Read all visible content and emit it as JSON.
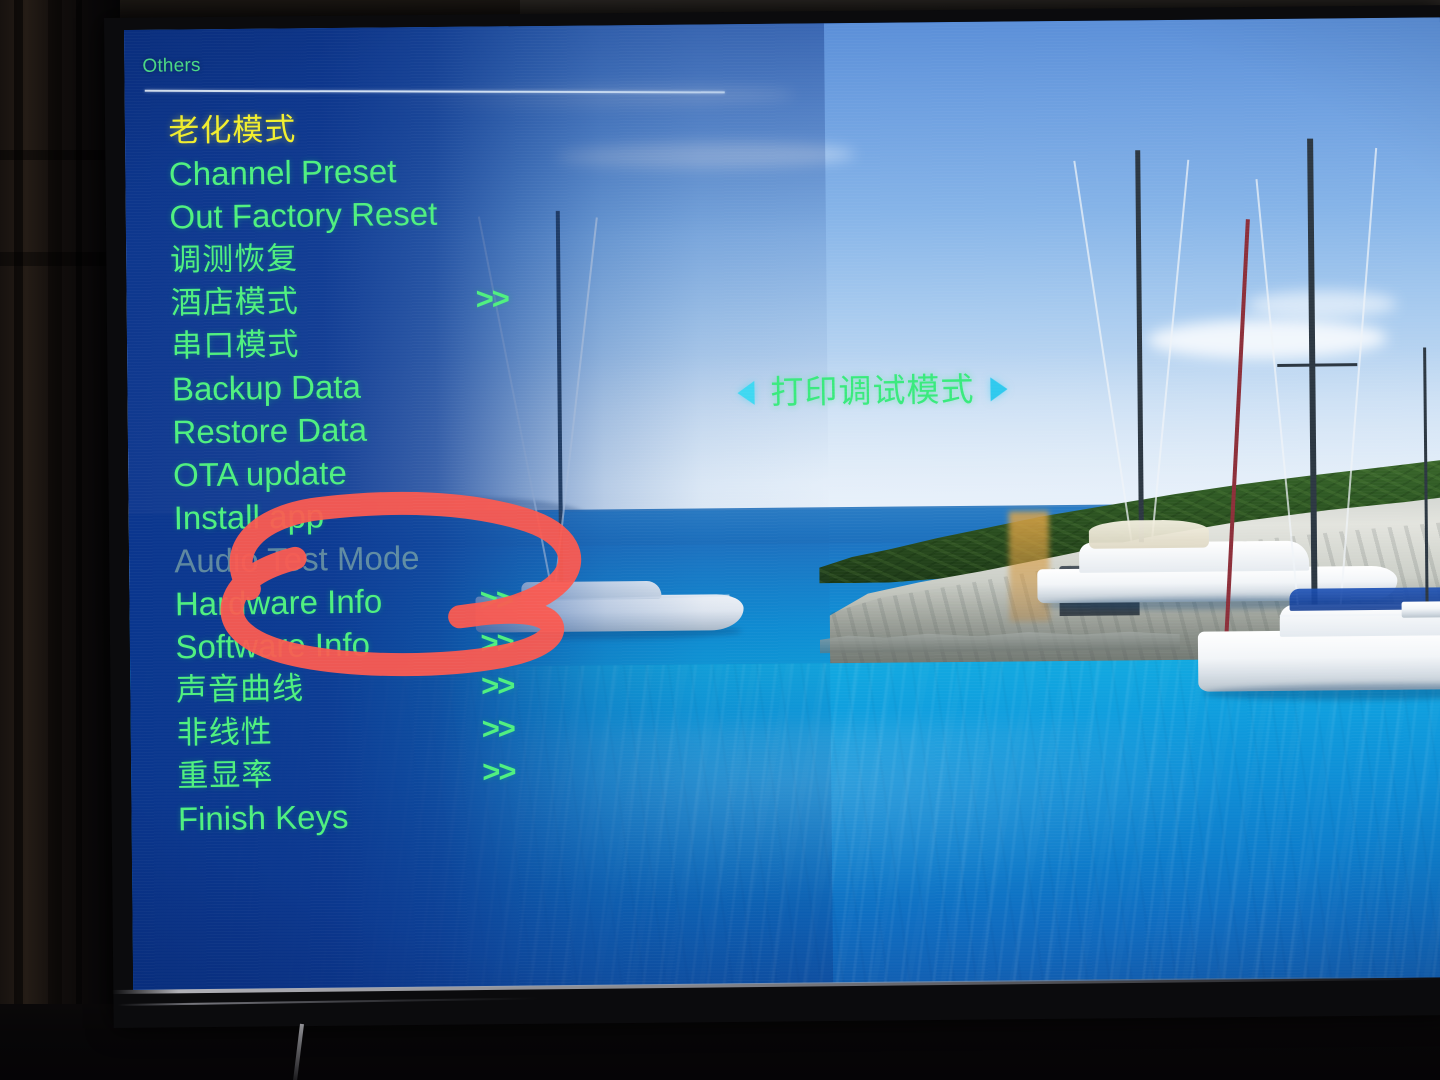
{
  "screen": {
    "menu": {
      "title": "Others",
      "items": [
        {
          "label": "老化模式",
          "script": "cjk",
          "arrows": "",
          "state": "selected"
        },
        {
          "label": "Channel Preset",
          "script": "latin",
          "arrows": "",
          "state": "normal"
        },
        {
          "label": "Out Factory Reset",
          "script": "latin",
          "arrows": "",
          "state": "normal"
        },
        {
          "label": "调测恢复",
          "script": "cjk",
          "arrows": "",
          "state": "normal"
        },
        {
          "label": "酒店模式",
          "script": "cjk",
          "arrows": ">>",
          "state": "normal"
        },
        {
          "label": "串口模式",
          "script": "cjk",
          "arrows": "",
          "state": "normal"
        },
        {
          "label": "Backup Data",
          "script": "latin",
          "arrows": "",
          "state": "normal"
        },
        {
          "label": "Restore Data",
          "script": "latin",
          "arrows": "",
          "state": "normal"
        },
        {
          "label": "OTA update",
          "script": "latin",
          "arrows": "",
          "state": "normal"
        },
        {
          "label": "Install app",
          "script": "latin",
          "arrows": "",
          "state": "normal"
        },
        {
          "label": "Audio Test Mode",
          "script": "latin",
          "arrows": "",
          "state": "disabled"
        },
        {
          "label": "Hardware Info",
          "script": "latin",
          "arrows": ">>",
          "state": "normal"
        },
        {
          "label": "Software Info",
          "script": "latin",
          "arrows": ">>",
          "state": "normal"
        },
        {
          "label": "声音曲线",
          "script": "cjk",
          "arrows": ">>",
          "state": "normal"
        },
        {
          "label": "非线性",
          "script": "cjk",
          "arrows": ">>",
          "state": "normal"
        },
        {
          "label": "重显率",
          "script": "cjk",
          "arrows": ">>",
          "state": "normal"
        },
        {
          "label": "Finish Keys",
          "script": "latin",
          "arrows": "",
          "state": "normal"
        }
      ]
    },
    "value_widget": {
      "left_arrow": "left-triangle-icon",
      "value": "打印调试模式",
      "right_arrow": "right-triangle-icon"
    },
    "wallpaper": {
      "description": "Mediterranean bay with moored sailboats, white limestone cliff and green scrub, turquoise water"
    }
  },
  "annotation": {
    "type": "hand-drawn-ellipse",
    "color": "#fb5a50",
    "targets": [
      "Install app",
      "Audio Test Mode"
    ]
  },
  "colors": {
    "menu_text_green": "#4ff07f",
    "menu_selected_yellow": "#f2ef2e",
    "menu_disabled": "#96beaa",
    "menu_title_green": "#4de08a",
    "value_green": "#39ea7d",
    "arrow_cyan": "#3fd8f2",
    "panel_blue": "#0a348c",
    "divider_white": "#e2ecf8",
    "annotation_red": "#fb5a50",
    "bezel_black": "#0b0b0d"
  }
}
